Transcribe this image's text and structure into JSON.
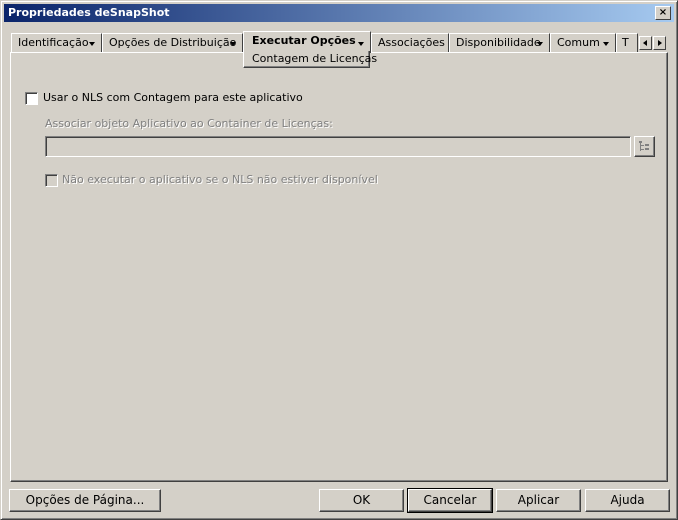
{
  "window": {
    "title": "Propriedades deSnapShot",
    "close_glyph": "×"
  },
  "tabs": [
    {
      "label": "Identificação"
    },
    {
      "label": "Opções de Distribuição"
    },
    {
      "label": "Executar Opções"
    },
    {
      "label": "Associações"
    },
    {
      "label": "Disponibilidade"
    },
    {
      "label": "Comum"
    },
    {
      "label": "T"
    }
  ],
  "subtab": {
    "label": "Contagem de Licenças"
  },
  "content": {
    "use_nls": {
      "label": "Usar o NLS com Contagem para este aplicativo",
      "checked": false
    },
    "associate_label": "Associar objeto Aplicativo ao Container de Licenças:",
    "container_value": "",
    "no_run": {
      "label": "Não executar o aplicativo se o NLS não estiver disponível",
      "checked": false
    }
  },
  "buttons": {
    "page_options": "Opções de Página...",
    "ok": "OK",
    "cancel": "Cancelar",
    "apply": "Aplicar",
    "help": "Ajuda"
  },
  "icons": {
    "scroll_left": "scroll-left-icon",
    "scroll_right": "scroll-right-icon",
    "browse": "browse-tree-icon"
  }
}
